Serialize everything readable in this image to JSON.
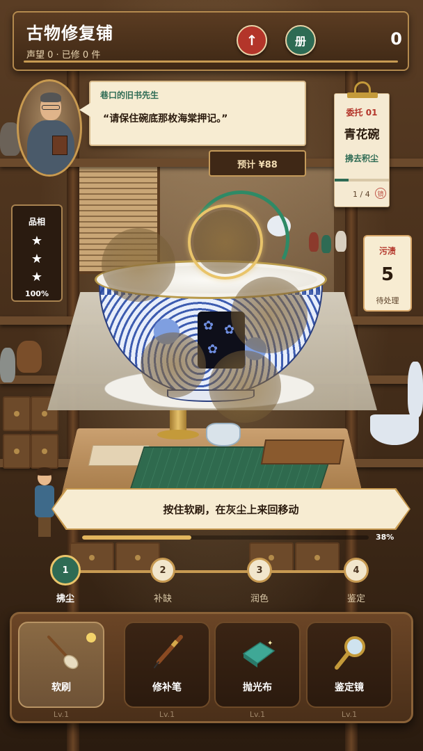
{
  "header": {
    "title": "古物修复铺",
    "subtitle": "声望 0 · 已修 0 件",
    "up_button": "↑",
    "book_button": "册",
    "score": "0"
  },
  "customer": {
    "name": "巷口的旧书先生",
    "quote": "“请保住碗底那枚海棠押记。”",
    "estimate": "预计 ¥88"
  },
  "commission": {
    "number": "委托 01",
    "item": "青花碗",
    "task": "拂去积尘",
    "page": "1 / 4",
    "seal": "镜",
    "progress_fraction": 0.25
  },
  "quality": {
    "label": "品相",
    "stars": [
      "★",
      "★",
      "★"
    ],
    "percent": "100%"
  },
  "stain": {
    "label": "污渍",
    "count": "5",
    "status": "待处理"
  },
  "instruction": {
    "text": "按住软刷，在灰尘上来回移动",
    "progress_percent": "38%",
    "progress_value": 0.38
  },
  "steps": [
    {
      "number": "1",
      "label": "拂尘",
      "active": true
    },
    {
      "number": "2",
      "label": "补缺",
      "active": false
    },
    {
      "number": "3",
      "label": "润色",
      "active": false
    },
    {
      "number": "4",
      "label": "鉴定",
      "active": false
    }
  ],
  "tools": [
    {
      "name": "软刷",
      "level": "Lv.1",
      "icon": "brush-icon",
      "selected": true
    },
    {
      "name": "修补笔",
      "level": "Lv.1",
      "icon": "pen-icon",
      "selected": false
    },
    {
      "name": "抛光布",
      "level": "Lv.1",
      "icon": "cloth-icon",
      "selected": false
    },
    {
      "name": "鉴定镜",
      "level": "Lv.1",
      "icon": "magnifier-icon",
      "selected": false
    }
  ],
  "colors": {
    "accent_green": "#2e6b54",
    "accent_red": "#b3352a",
    "gold": "#c79a52",
    "paper": "#f7ecd2"
  }
}
